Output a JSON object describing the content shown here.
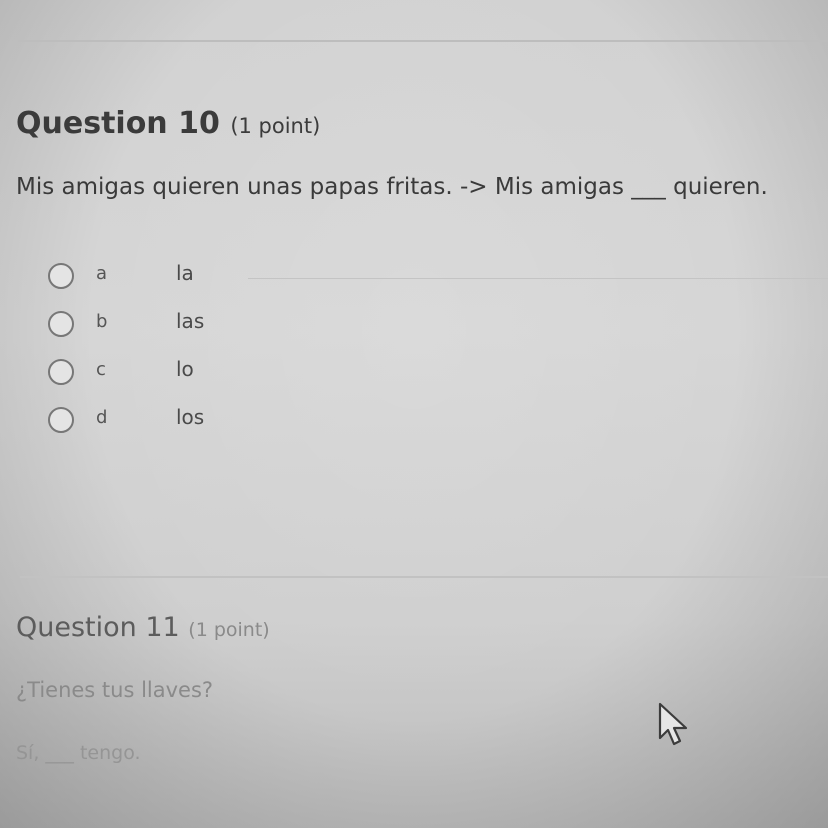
{
  "question10": {
    "title": "Question 10",
    "points": "(1 point)",
    "prompt": "Mis amigas quieren unas papas fritas. -> Mis amigas ___ quieren.",
    "options": [
      {
        "letter": "a",
        "text": "la"
      },
      {
        "letter": "b",
        "text": "las"
      },
      {
        "letter": "c",
        "text": "lo"
      },
      {
        "letter": "d",
        "text": "los"
      }
    ]
  },
  "question11": {
    "title": "Question 11",
    "points": "(1 point)",
    "prompt": "¿Tienes tus llaves?",
    "sentence": "Sí, ___ tengo."
  },
  "cursor": {
    "icon": "arrow-pointer-icon"
  }
}
